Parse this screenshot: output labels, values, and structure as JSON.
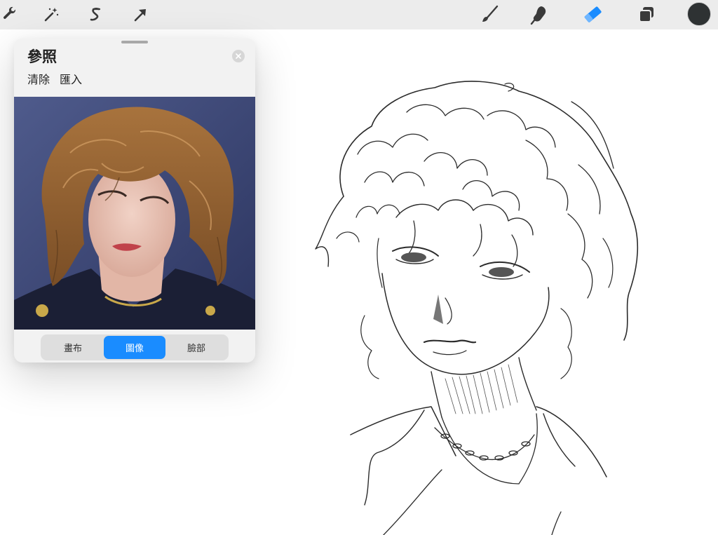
{
  "toolbar": {
    "left_tools": [
      {
        "name": "wrench-icon",
        "label": "Actions"
      },
      {
        "name": "magic-wand-icon",
        "label": "Adjustments"
      },
      {
        "name": "selection-icon",
        "label": "Selection"
      },
      {
        "name": "transform-arrow-icon",
        "label": "Transform"
      }
    ],
    "right_tools": [
      {
        "name": "brush-icon",
        "label": "Paint"
      },
      {
        "name": "smudge-icon",
        "label": "Smudge"
      },
      {
        "name": "eraser-icon",
        "label": "Erase"
      },
      {
        "name": "layers-icon",
        "label": "Layers"
      }
    ],
    "active_tool": "eraser-icon",
    "active_color": "#2e3233"
  },
  "reference": {
    "title": "參照",
    "clear_label": "清除",
    "import_label": "匯入",
    "tabs": [
      {
        "label": "畫布",
        "active": false
      },
      {
        "label": "圖像",
        "active": true
      },
      {
        "label": "臉部",
        "active": false
      }
    ],
    "accent_color": "#1a8cff"
  }
}
